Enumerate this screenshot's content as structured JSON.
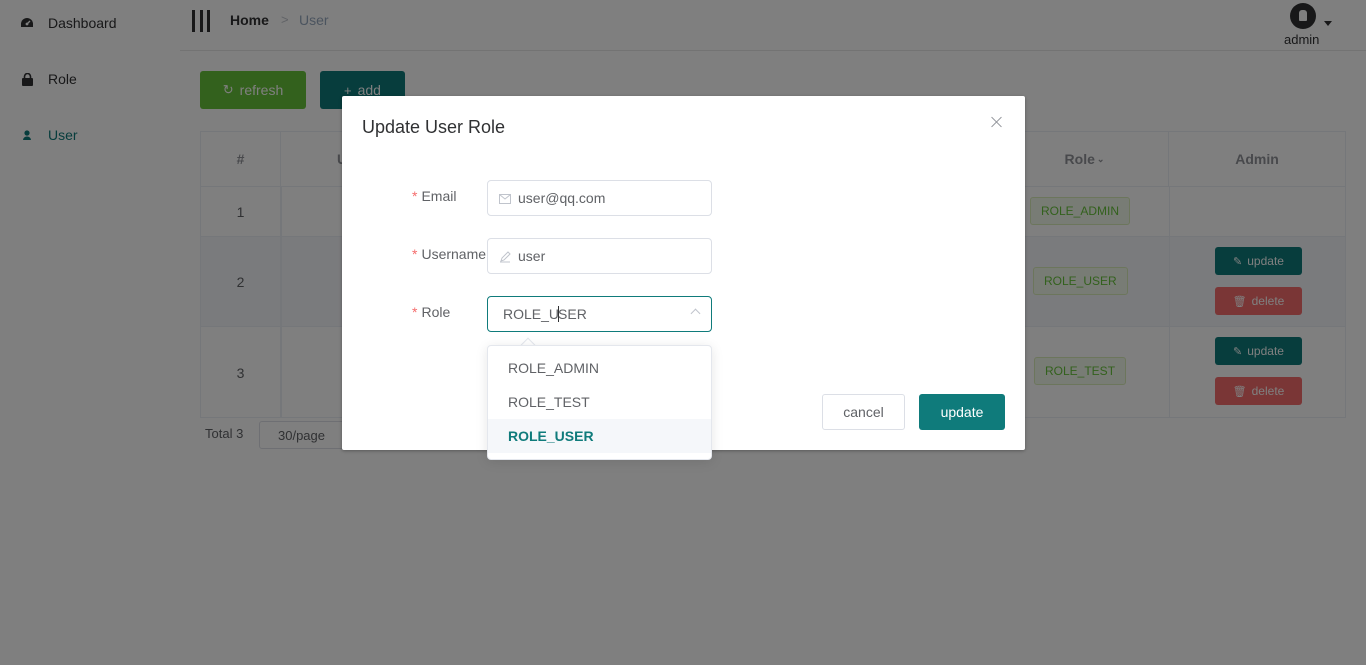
{
  "sidebar": {
    "items": [
      {
        "label": "Dashboard",
        "icon": "dashboard-icon"
      },
      {
        "label": "Role",
        "icon": "lock-icon"
      },
      {
        "label": "User",
        "icon": "user-icon"
      }
    ]
  },
  "header": {
    "breadcrumb_home": "Home",
    "breadcrumb_separator": ">",
    "breadcrumb_current": "User",
    "username": "admin"
  },
  "toolbar": {
    "refresh_label": "refresh",
    "add_label": "add"
  },
  "table": {
    "headers": [
      "#",
      "U",
      "Role",
      "Admin"
    ],
    "rows": [
      {
        "index": "1",
        "role": "ROLE_ADMIN"
      },
      {
        "index": "2",
        "role": "ROLE_USER",
        "update_label": "update",
        "delete_label": "delete"
      },
      {
        "index": "3",
        "role": "ROLE_TEST",
        "update_label": "update",
        "delete_label": "delete"
      }
    ]
  },
  "pagination": {
    "total": "Total 3",
    "page_size": "30/page"
  },
  "dialog": {
    "title": "Update User Role",
    "email_label": "Email",
    "email_value": "user@qq.com",
    "username_label": "Username",
    "username_value": "user",
    "role_label": "Role",
    "role_value_before_caret": "ROLE_U",
    "role_value_after_caret": "SER",
    "cancel_label": "cancel",
    "update_label": "update",
    "role_options": [
      "ROLE_ADMIN",
      "ROLE_TEST",
      "ROLE_USER"
    ],
    "selected_option": "ROLE_USER"
  },
  "colors": {
    "primary": "#0f7b7b",
    "success": "#67c23a",
    "danger": "#f56c6c"
  }
}
